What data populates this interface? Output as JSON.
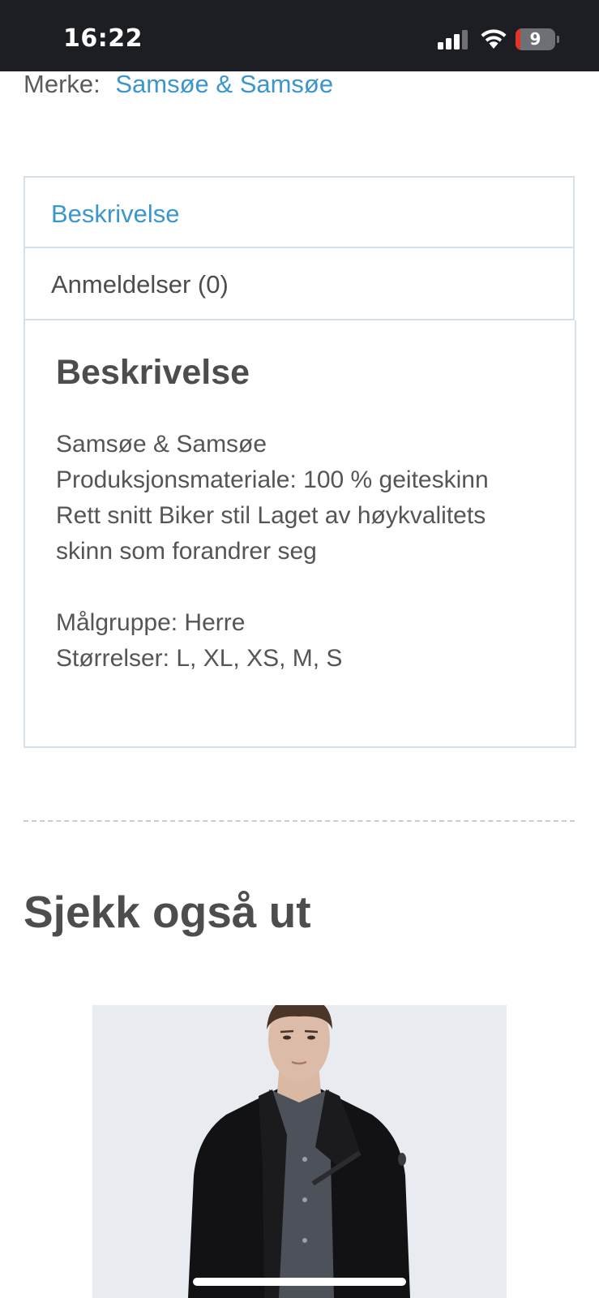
{
  "status_bar": {
    "time": "16:22",
    "battery_level": "9",
    "battery_fraction": 0.09,
    "icons": [
      "signal-icon",
      "wifi-icon",
      "battery-icon"
    ]
  },
  "brand": {
    "label": "Merke:",
    "name": "Samsøe & Samsøe"
  },
  "tabs": [
    {
      "label": "Beskrivelse",
      "active": true
    },
    {
      "label": "Anmeldelser (0)",
      "active": false
    }
  ],
  "description": {
    "title": "Beskrivelse",
    "lines": [
      "Samsøe & Samsøe",
      "Produksjonsmateriale: 100 % geiteskinn",
      "Rett snitt Biker stil Laget av høykvalitets",
      "skinn som forandrer seg"
    ],
    "target_group": "Målgruppe: Herre",
    "sizes": "Størrelser: L, XL, XS, M, S"
  },
  "related": {
    "title": "Sjekk også ut"
  },
  "colors": {
    "status_bar_bg": "#1d1e23",
    "link": "#3a96cc",
    "text": "#555555",
    "border": "#d6e0e8",
    "battery_low": "#e5332a"
  }
}
